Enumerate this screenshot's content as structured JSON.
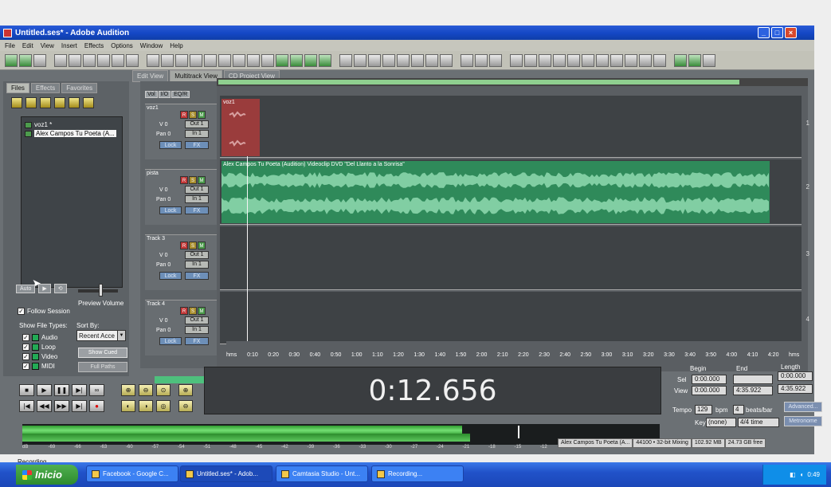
{
  "window": {
    "title": "Untitled.ses* - Adobe Audition"
  },
  "menu": [
    "File",
    "Edit",
    "View",
    "Insert",
    "Effects",
    "Options",
    "Window",
    "Help"
  ],
  "left_panel": {
    "tabs": [
      "Files",
      "Effects",
      "Favorites"
    ],
    "files": [
      "voz1 *",
      "Alex Campos   Tu Poeta (A..."
    ],
    "auto_label": "Auto",
    "preview_volume_label": "Preview Volume",
    "follow_session_label": "Follow Session",
    "follow_session_checked": true,
    "show_file_types_label": "Show File Types:",
    "sort_by_label": "Sort By:",
    "file_types": [
      "Audio",
      "Loop",
      "Video",
      "MIDI"
    ],
    "sort_value": "Recent Acce",
    "show_cued_label": "Show Cued",
    "full_paths_label": "Full Paths"
  },
  "view_tabs": [
    "Edit View",
    "Multitrack View",
    "CD Project View"
  ],
  "vol_tabs": [
    "Vol",
    "I/O",
    "EQ/R"
  ],
  "tracks": [
    {
      "name": "voz1",
      "vol": "V 0",
      "pan": "Pan 0",
      "out": "Out 1",
      "in": "In 1",
      "lock": "Lock",
      "fx": "FX",
      "number": "1"
    },
    {
      "name": "pista",
      "vol": "V 0",
      "pan": "Pan 0",
      "out": "Out 1",
      "in": "In 1",
      "lock": "Lock",
      "fx": "FX",
      "number": "2"
    },
    {
      "name": "Track 3",
      "vol": "V 0",
      "pan": "Pan 0",
      "out": "Out 1",
      "in": "In 1",
      "lock": "Lock",
      "fx": "FX",
      "number": "3"
    },
    {
      "name": "Track 4",
      "vol": "V 0",
      "pan": "Pan 0",
      "out": "Out 1",
      "in": "In 1",
      "lock": "Lock",
      "fx": "FX",
      "number": "4"
    }
  ],
  "track_buttons": {
    "r": "R",
    "s": "S",
    "m": "M"
  },
  "clips": {
    "voz1": "voz1",
    "pista": "Alex Campos  Tu Poeta (Audition)  Videoclip  DVD \"Del Llanto a la Sonrisa\""
  },
  "ruler_labels": [
    "hms",
    "0:10",
    "0:20",
    "0:30",
    "0:40",
    "0:50",
    "1:00",
    "1:10",
    "1:20",
    "1:30",
    "1:40",
    "1:50",
    "2:00",
    "2:10",
    "2:20",
    "2:30",
    "2:40",
    "2:50",
    "3:00",
    "3:10",
    "3:20",
    "3:30",
    "3:40",
    "3:50",
    "4:00",
    "4:10",
    "4:20",
    "hms"
  ],
  "time_display": "0:12.656",
  "selection": {
    "headers": [
      "Begin",
      "End",
      "Length"
    ],
    "sel_label": "Sel",
    "view_label": "View",
    "sel_begin": "0:00.000",
    "sel_length": "0:00.000",
    "view_begin": "0:00.000",
    "view_end": "4:35.922",
    "view_length": "4:35.922"
  },
  "tempo": {
    "tempo_label": "Tempo",
    "tempo_value": "129",
    "bpm_label": "bpm",
    "beats_value": "4",
    "beats_label": "beats/bar",
    "key_label": "Key",
    "key_value": "(none)",
    "time_sig": "4/4 time",
    "advanced_label": "Advanced...",
    "metronome_label": "Metronome"
  },
  "meter": {
    "level_fraction": 0.69,
    "scale": [
      "dB",
      "-69",
      "-66",
      "-63",
      "-60",
      "-57",
      "-54",
      "-51",
      "-48",
      "-45",
      "-42",
      "-39",
      "-36",
      "-33",
      "-30",
      "-27",
      "-24",
      "-21",
      "-18",
      "-15",
      "-12",
      "-9",
      "-6",
      "-3",
      "0"
    ]
  },
  "status": {
    "cells": [
      "Alex Campos   Tu Poeta (A...",
      "44100 • 32-bit Mixing",
      "102.92 MB",
      "24.73 GB free"
    ],
    "bottom": "Recording"
  },
  "taskbar": {
    "start": "Inicio",
    "tasks": [
      "Facebook - Google C...",
      "Untitled.ses* - Adob...",
      "Camtasia Studio - Unt...",
      "Recording..."
    ],
    "clock": "0:49"
  },
  "colors": {
    "accent": "#1447c4",
    "clip_green": "#2f8a5a",
    "wave_green": "#8fd9b0",
    "clip_red": "#9a3c3c"
  }
}
